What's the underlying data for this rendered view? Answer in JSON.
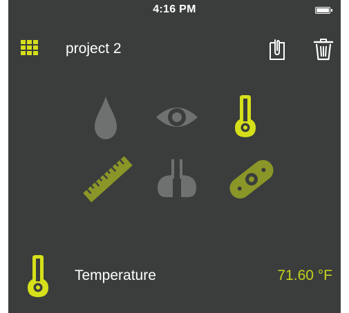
{
  "status_bar": {
    "time": "4:16 PM",
    "battery_icon": "battery-full-icon"
  },
  "header": {
    "title": "project 2",
    "menu_icon": "grid-menu-icon",
    "attach_icon": "paperclip-document-icon",
    "delete_icon": "trash-icon"
  },
  "sensors": [
    {
      "name": "humidity",
      "icon": "water-drop-icon",
      "active": false
    },
    {
      "name": "light",
      "icon": "eye-icon",
      "active": false
    },
    {
      "name": "temperature",
      "icon": "thermometer-icon",
      "active": true
    },
    {
      "name": "distance",
      "icon": "ruler-icon",
      "active": false
    },
    {
      "name": "sound",
      "icon": "earbuds-icon",
      "active": false
    },
    {
      "name": "level",
      "icon": "level-icon",
      "active": false
    }
  ],
  "readout": {
    "icon": "thermometer-icon",
    "label": "Temperature",
    "value": "71.60 °F"
  },
  "colors": {
    "background": "#3a3d3c",
    "accent": "#c6d31b",
    "inactive_gray": "#6e716f",
    "inactive_olive": "#8a9627",
    "text": "#ffffff"
  }
}
